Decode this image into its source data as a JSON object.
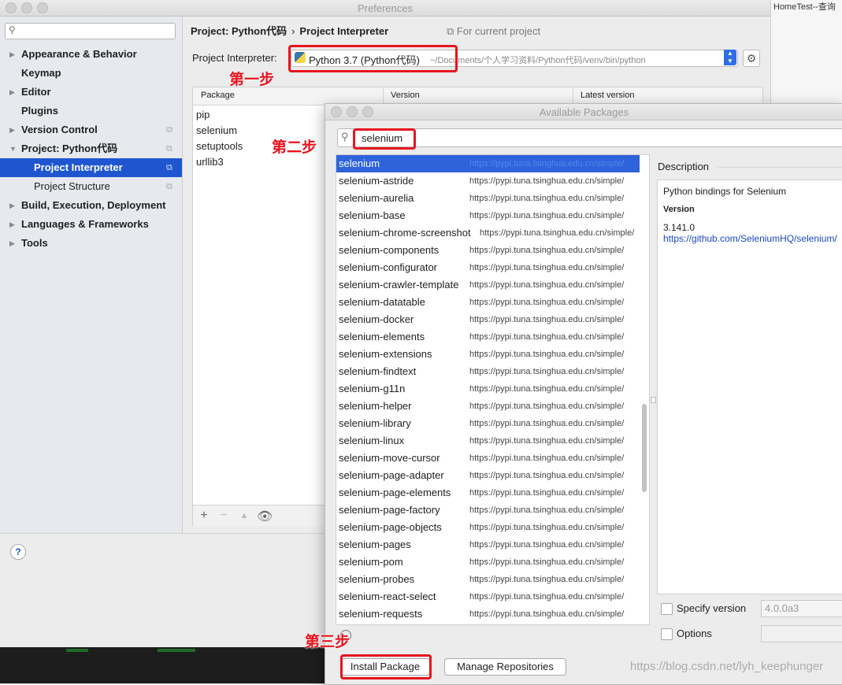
{
  "background": {
    "right_window_text": "HomeTest--查询"
  },
  "preferences": {
    "title": "Preferences",
    "sidebar": {
      "search_placeholder": "",
      "items": [
        {
          "label": "Appearance & Behavior",
          "arrow": "▶"
        },
        {
          "label": "Keymap"
        },
        {
          "label": "Editor",
          "arrow": "▶"
        },
        {
          "label": "Plugins"
        },
        {
          "label": "Version Control",
          "arrow": "▶"
        },
        {
          "label": "Project: Python代码",
          "arrow": "▼"
        },
        {
          "label": "Project Interpreter"
        },
        {
          "label": "Project Structure"
        },
        {
          "label": "Build, Execution, Deployment",
          "arrow": "▶"
        },
        {
          "label": "Languages & Frameworks",
          "arrow": "▶"
        },
        {
          "label": "Tools",
          "arrow": "▶"
        }
      ]
    },
    "breadcrumb": {
      "project": "Project: Python代码",
      "separator": "›",
      "page": "Project Interpreter"
    },
    "for_current_project": "For current project",
    "interpreter": {
      "label": "Project Interpreter:",
      "name": "Python 3.7 (Python代码)",
      "path": "~/Documents/个人学习资料/Python代码/venv/bin/python"
    },
    "packages_table": {
      "columns": [
        "Package",
        "Version",
        "Latest version"
      ],
      "rows": [
        "pip",
        "selenium",
        "setuptools",
        "urllib3"
      ]
    },
    "help_label": "?"
  },
  "dialog": {
    "title": "Available Packages",
    "search_value": "selenium",
    "repo_url": "https://pypi.tuna.tsinghua.edu.cn/simple/",
    "packages": [
      "selenium",
      "selenium-astride",
      "selenium-aurelia",
      "selenium-base",
      "selenium-chrome-screenshot",
      "selenium-components",
      "selenium-configurator",
      "selenium-crawler-template",
      "selenium-datatable",
      "selenium-docker",
      "selenium-elements",
      "selenium-extensions",
      "selenium-findtext",
      "selenium-g11n",
      "selenium-helper",
      "selenium-library",
      "selenium-linux",
      "selenium-move-cursor",
      "selenium-page-adapter",
      "selenium-page-elements",
      "selenium-page-factory",
      "selenium-page-objects",
      "selenium-pages",
      "selenium-pom",
      "selenium-probes",
      "selenium-react-select",
      "selenium-requests"
    ],
    "selected_package": "selenium",
    "description": {
      "heading": "Description",
      "text": "Python bindings for Selenium",
      "version_heading": "Version",
      "version": "3.141.0",
      "link": "https://github.com/SeleniumHQ/selenium/"
    },
    "specify_version_label": "Specify version",
    "specify_version_value": "4.0.0a3",
    "options_label": "Options",
    "install_button": "Install Package",
    "manage_button": "Manage Repositories"
  },
  "annotations": {
    "step1": "第一步",
    "step2": "第二步",
    "step3": "第三步"
  },
  "watermark": "https://blog.csdn.net/lyh_keephunger",
  "colors": {
    "selection": "#1f56d0",
    "annotation_red": "#e8141e",
    "link": "#1a47c7"
  }
}
